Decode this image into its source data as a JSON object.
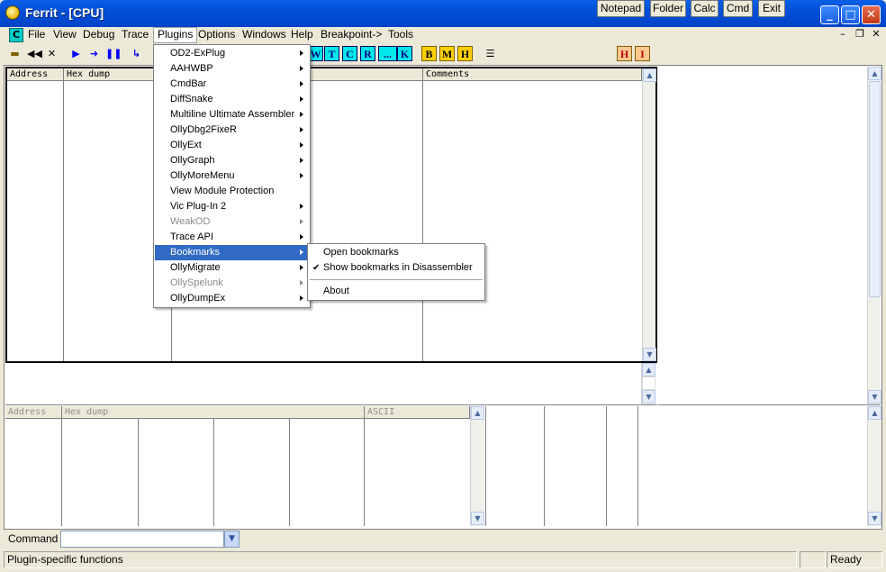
{
  "window": {
    "title": "Ferrit - [CPU]"
  },
  "title_buttons": [
    "Notepad",
    "Folder",
    "Calc",
    "Cmd",
    "Exit"
  ],
  "menubar": {
    "items": [
      "File",
      "View",
      "Debug",
      "Trace",
      "Plugins",
      "Options",
      "Windows",
      "Help",
      "Breakpoint->",
      "Tools"
    ],
    "active": "Plugins"
  },
  "toolbar": {
    "letter_buttons": [
      "W",
      "T",
      "C",
      "R",
      "...",
      "K",
      "B",
      "M",
      "H",
      "H",
      "I"
    ]
  },
  "disasm_pane": {
    "headers": [
      "Address",
      "Hex dump",
      "Comments"
    ]
  },
  "dump_pane": {
    "headers": [
      "Address",
      "Hex dump",
      "ASCII"
    ]
  },
  "command": {
    "label": "Command :",
    "value": ""
  },
  "status": {
    "message": "Plugin-specific functions",
    "state": "Ready"
  },
  "plugins_menu": [
    {
      "label": "OD2-ExPlug",
      "submenu": true,
      "disabled": false
    },
    {
      "label": "AAHWBP",
      "submenu": true,
      "disabled": false
    },
    {
      "label": "CmdBar",
      "submenu": true,
      "disabled": false
    },
    {
      "label": "DiffSnake",
      "submenu": true,
      "disabled": false
    },
    {
      "label": "Multiline Ultimate Assembler",
      "submenu": true,
      "disabled": false
    },
    {
      "label": "OllyDbg2FixeR",
      "submenu": true,
      "disabled": false
    },
    {
      "label": "OllyExt",
      "submenu": true,
      "disabled": false
    },
    {
      "label": "OllyGraph",
      "submenu": true,
      "disabled": false
    },
    {
      "label": "OllyMoreMenu",
      "submenu": true,
      "disabled": false
    },
    {
      "label": "View Module Protection",
      "submenu": false,
      "disabled": false
    },
    {
      "label": "Vic Plug-In 2",
      "submenu": true,
      "disabled": false
    },
    {
      "label": "WeakOD",
      "submenu": true,
      "disabled": true
    },
    {
      "label": "Trace API",
      "submenu": true,
      "disabled": false
    },
    {
      "label": "Bookmarks",
      "submenu": true,
      "disabled": false,
      "selected": true
    },
    {
      "label": "OllyMigrate",
      "submenu": true,
      "disabled": false
    },
    {
      "label": "OllySpelunk",
      "submenu": true,
      "disabled": true
    },
    {
      "label": "OllyDumpEx",
      "submenu": true,
      "disabled": false
    }
  ],
  "bookmarks_menu": {
    "items": [
      {
        "label": "Open bookmarks",
        "checked": false
      },
      {
        "label": "Show bookmarks in Disassembler",
        "checked": true
      }
    ],
    "about": "About"
  },
  "colors": {
    "titlebar": "#0043c8",
    "menu_highlight": "#316ac5",
    "disabled_text": "#8a8a8a"
  }
}
